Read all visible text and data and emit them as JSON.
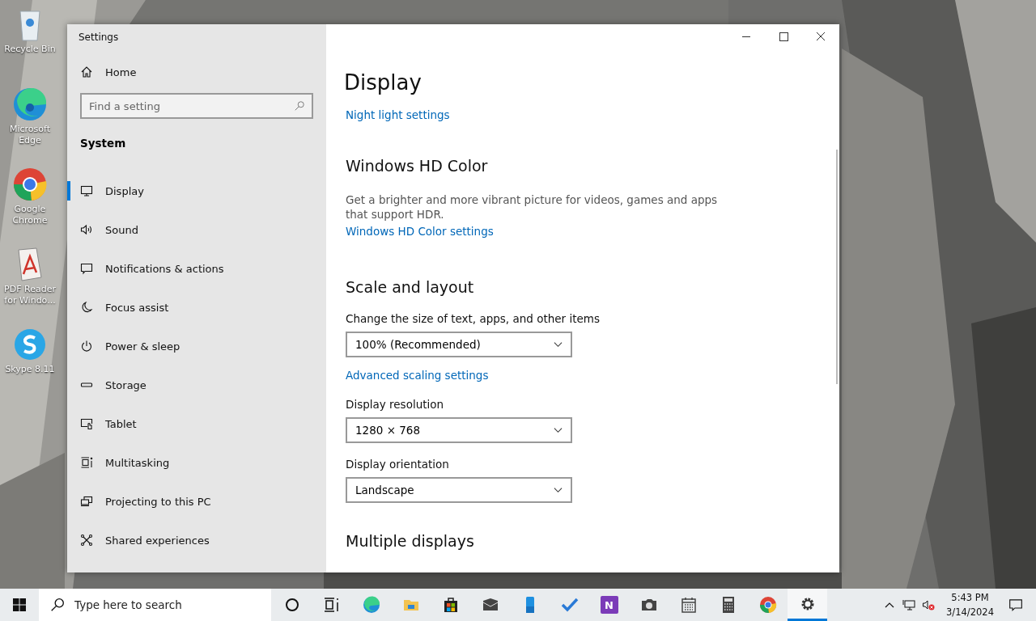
{
  "desktop_icons": [
    {
      "kind": "recycle",
      "label": "Recycle Bin"
    },
    {
      "kind": "edge",
      "label": "Microsoft Edge"
    },
    {
      "kind": "chrome",
      "label": "Google Chrome"
    },
    {
      "kind": "pdf",
      "label": "PDF Reader for Windo..."
    },
    {
      "kind": "skype",
      "label": "Skype 8.11"
    }
  ],
  "window": {
    "title": "Settings",
    "sidebar": {
      "home": "Home",
      "search": {
        "placeholder": "Find a setting"
      },
      "section": "System",
      "items": [
        {
          "kind": "display",
          "label": "Display",
          "selected": true
        },
        {
          "kind": "sound",
          "label": "Sound",
          "selected": false
        },
        {
          "kind": "notifications",
          "label": "Notifications & actions",
          "selected": false
        },
        {
          "kind": "focus",
          "label": "Focus assist",
          "selected": false
        },
        {
          "kind": "power",
          "label": "Power & sleep",
          "selected": false
        },
        {
          "kind": "storage",
          "label": "Storage",
          "selected": false
        },
        {
          "kind": "tablet",
          "label": "Tablet",
          "selected": false
        },
        {
          "kind": "multitasking",
          "label": "Multitasking",
          "selected": false
        },
        {
          "kind": "projecting",
          "label": "Projecting to this PC",
          "selected": false
        },
        {
          "kind": "shared",
          "label": "Shared experiences",
          "selected": false
        }
      ]
    },
    "page_title": "Display",
    "night_light_link": "Night light settings",
    "hd_color": {
      "heading": "Windows HD Color",
      "description": "Get a brighter and more vibrant picture for videos, games and apps that support HDR.",
      "link": "Windows HD Color settings"
    },
    "scale_layout": {
      "heading": "Scale and layout",
      "size_label": "Change the size of text, apps, and other items",
      "size_value": "100% (Recommended)",
      "advanced_link": "Advanced scaling settings",
      "resolution_label": "Display resolution",
      "resolution_value": "1280 × 768",
      "orientation_label": "Display orientation",
      "orientation_value": "Landscape"
    },
    "multiple_displays": {
      "heading": "Multiple displays"
    }
  },
  "taskbar": {
    "search": {
      "placeholder": "Type here to search"
    },
    "apps": [
      {
        "kind": "cortana",
        "active": false
      },
      {
        "kind": "taskview",
        "active": false
      },
      {
        "kind": "edge",
        "active": false
      },
      {
        "kind": "explorer",
        "active": false
      },
      {
        "kind": "store",
        "active": false
      },
      {
        "kind": "mail",
        "active": false
      },
      {
        "kind": "phone",
        "active": false
      },
      {
        "kind": "todo",
        "active": false
      },
      {
        "kind": "onenote",
        "active": false,
        "label": "N"
      },
      {
        "kind": "camera",
        "active": false
      },
      {
        "kind": "calendar",
        "active": false
      },
      {
        "kind": "calculator",
        "active": false
      },
      {
        "kind": "chrome",
        "active": false
      },
      {
        "kind": "settings",
        "active": true
      }
    ],
    "time": "5:43 PM",
    "date": "3/14/2024"
  }
}
